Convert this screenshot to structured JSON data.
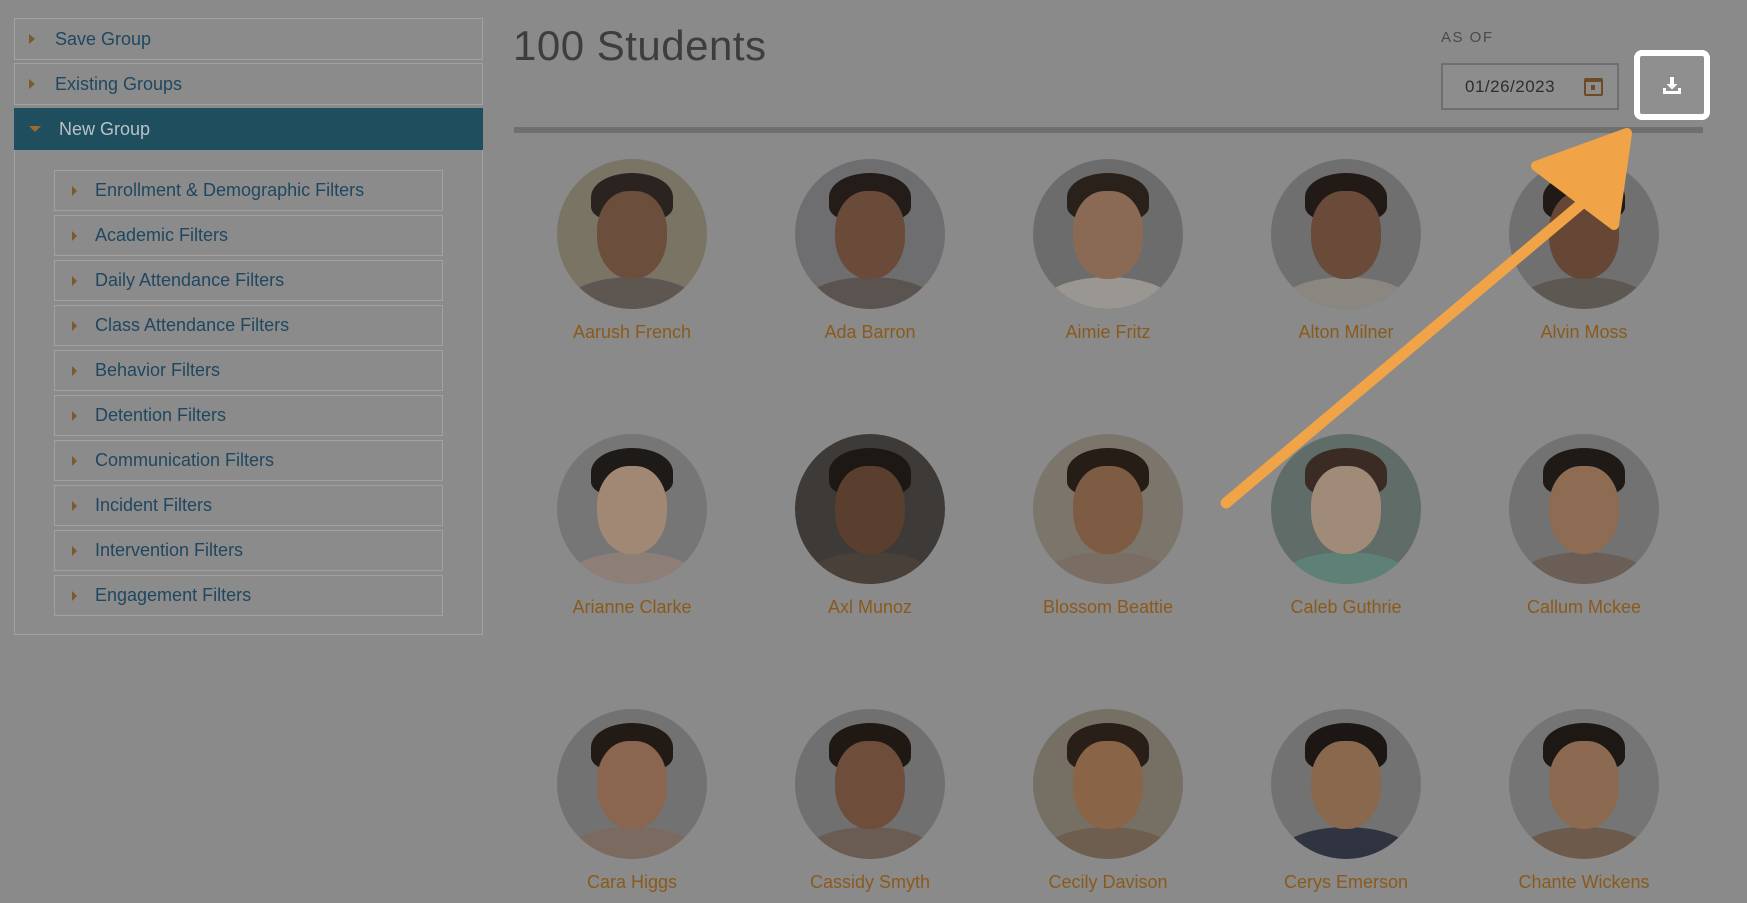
{
  "sidebar": {
    "sections": [
      {
        "label": "Save Group"
      },
      {
        "label": "Existing Groups"
      },
      {
        "label": "New Group"
      }
    ],
    "filters": [
      {
        "label": "Enrollment & Demographic Filters"
      },
      {
        "label": "Academic Filters"
      },
      {
        "label": "Daily Attendance Filters"
      },
      {
        "label": "Class Attendance Filters"
      },
      {
        "label": "Behavior Filters"
      },
      {
        "label": "Detention Filters"
      },
      {
        "label": "Communication Filters"
      },
      {
        "label": "Incident Filters"
      },
      {
        "label": "Intervention Filters"
      },
      {
        "label": "Engagement Filters"
      }
    ]
  },
  "header": {
    "title": "100 Students",
    "as_of_label": "AS OF",
    "date_value": "01/26/2023"
  },
  "icons": {
    "calendar": "calendar-icon",
    "download": "download-icon"
  },
  "colors": {
    "accent_orange": "#f0a447",
    "active_section": "#1f4e5e",
    "name_text": "#8a5a1c"
  },
  "students": [
    {
      "name": "Aarush French"
    },
    {
      "name": "Ada Barron"
    },
    {
      "name": "Aimie Fritz"
    },
    {
      "name": "Alton Milner"
    },
    {
      "name": "Alvin Moss"
    },
    {
      "name": "Arianne Clarke"
    },
    {
      "name": "Axl Munoz"
    },
    {
      "name": "Blossom Beattie"
    },
    {
      "name": "Caleb Guthrie"
    },
    {
      "name": "Callum Mckee"
    },
    {
      "name": "Cara Higgs"
    },
    {
      "name": "Cassidy Smyth"
    },
    {
      "name": "Cecily Davison"
    },
    {
      "name": "Cerys Emerson"
    },
    {
      "name": "Chante Wickens"
    }
  ]
}
